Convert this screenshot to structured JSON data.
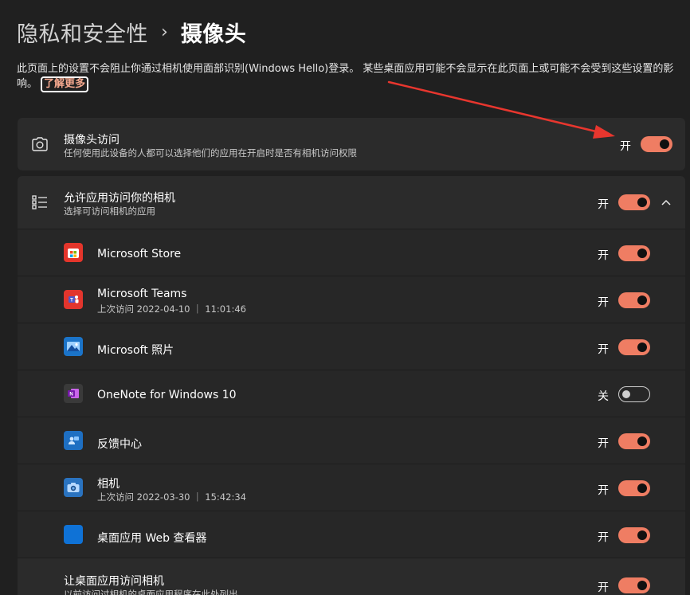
{
  "breadcrumb": {
    "parent": "隐私和安全性",
    "separator": "›",
    "current": "摄像头"
  },
  "description": {
    "text": "此页面上的设置不会阻止你通过相机使用面部识别(Windows Hello)登录。 某些桌面应用可能不会显示在此页面上或可能不会受到这些设置的影响。",
    "learn_more": "了解更多"
  },
  "camera_access": {
    "title": "摄像头访问",
    "subtitle": "任何使用此设备的人都可以选择他们的应用在开启时是否有相机访问权限",
    "state_label": "开",
    "enabled": true,
    "icon": "camera-icon"
  },
  "app_access": {
    "title": "允许应用访问你的相机",
    "subtitle": "选择可访问相机的应用",
    "state_label": "开",
    "enabled": true,
    "icon": "list-icon",
    "apps": [
      {
        "name": "Microsoft Store",
        "last_access": "",
        "state_label": "开",
        "enabled": true,
        "icon": "microsoft-store-icon",
        "color": "#e4352b"
      },
      {
        "name": "Microsoft Teams",
        "last_access": "上次访问 2022-04-10 ｜ 11:01:46",
        "state_label": "开",
        "enabled": true,
        "icon": "teams-icon",
        "color": "#e2352d"
      },
      {
        "name": "Microsoft 照片",
        "last_access": "",
        "state_label": "开",
        "enabled": true,
        "icon": "photos-icon",
        "color": "#1b74c9"
      },
      {
        "name": "OneNote for Windows 10",
        "last_access": "",
        "state_label": "关",
        "enabled": false,
        "icon": "onenote-icon",
        "color": "#3a3a3a"
      },
      {
        "name": "反馈中心",
        "last_access": "",
        "state_label": "开",
        "enabled": true,
        "icon": "feedback-hub-icon",
        "color": "#1e6fc2"
      },
      {
        "name": "相机",
        "last_access": "上次访问 2022-03-30 ｜ 15:42:34",
        "state_label": "开",
        "enabled": true,
        "icon": "camera-app-icon",
        "color": "#2a73c0"
      },
      {
        "name": "桌面应用 Web 查看器",
        "last_access": "",
        "state_label": "开",
        "enabled": true,
        "icon": "web-viewer-icon",
        "color": "#0f72d6"
      }
    ]
  },
  "desktop_access": {
    "title": "让桌面应用访问相机",
    "subtitle": "以前访问过相机的桌面应用程序在此处列出",
    "state_label": "开",
    "enabled": true
  },
  "colors": {
    "accent": "#ef7d63",
    "background": "#202020",
    "card": "#2b2b2b",
    "annotation_arrow": "#e8362e"
  }
}
